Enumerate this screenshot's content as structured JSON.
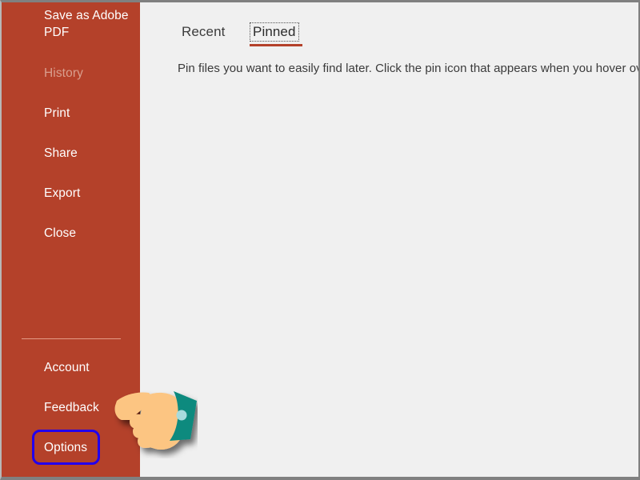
{
  "sidebar": {
    "accent_color": "#b4412a",
    "items": [
      {
        "id": "save-as-adobe-pdf",
        "label": "Save as Adobe PDF",
        "disabled": false
      },
      {
        "id": "history",
        "label": "History",
        "disabled": true
      },
      {
        "id": "print",
        "label": "Print",
        "disabled": false
      },
      {
        "id": "share",
        "label": "Share",
        "disabled": false
      },
      {
        "id": "export",
        "label": "Export",
        "disabled": false
      },
      {
        "id": "close",
        "label": "Close",
        "disabled": false
      },
      {
        "id": "account",
        "label": "Account",
        "disabled": false
      },
      {
        "id": "feedback",
        "label": "Feedback",
        "disabled": false
      },
      {
        "id": "options",
        "label": "Options",
        "disabled": false
      }
    ]
  },
  "highlight": {
    "target": "Options",
    "color": "#2200ee"
  },
  "content": {
    "tabs": [
      {
        "id": "recent",
        "label": "Recent",
        "selected": false
      },
      {
        "id": "pinned",
        "label": "Pinned",
        "selected": true
      }
    ],
    "active_tab_underline_color": "#b4412a",
    "description": "Pin files you want to easily find later. Click the pin icon that appears when you hover over a file."
  },
  "cursor": {
    "icon": "pointing-hand-cursor",
    "sleeve_color": "#108a7e",
    "skin_color": "#fcc582",
    "button_color": "#a8dbdd"
  }
}
